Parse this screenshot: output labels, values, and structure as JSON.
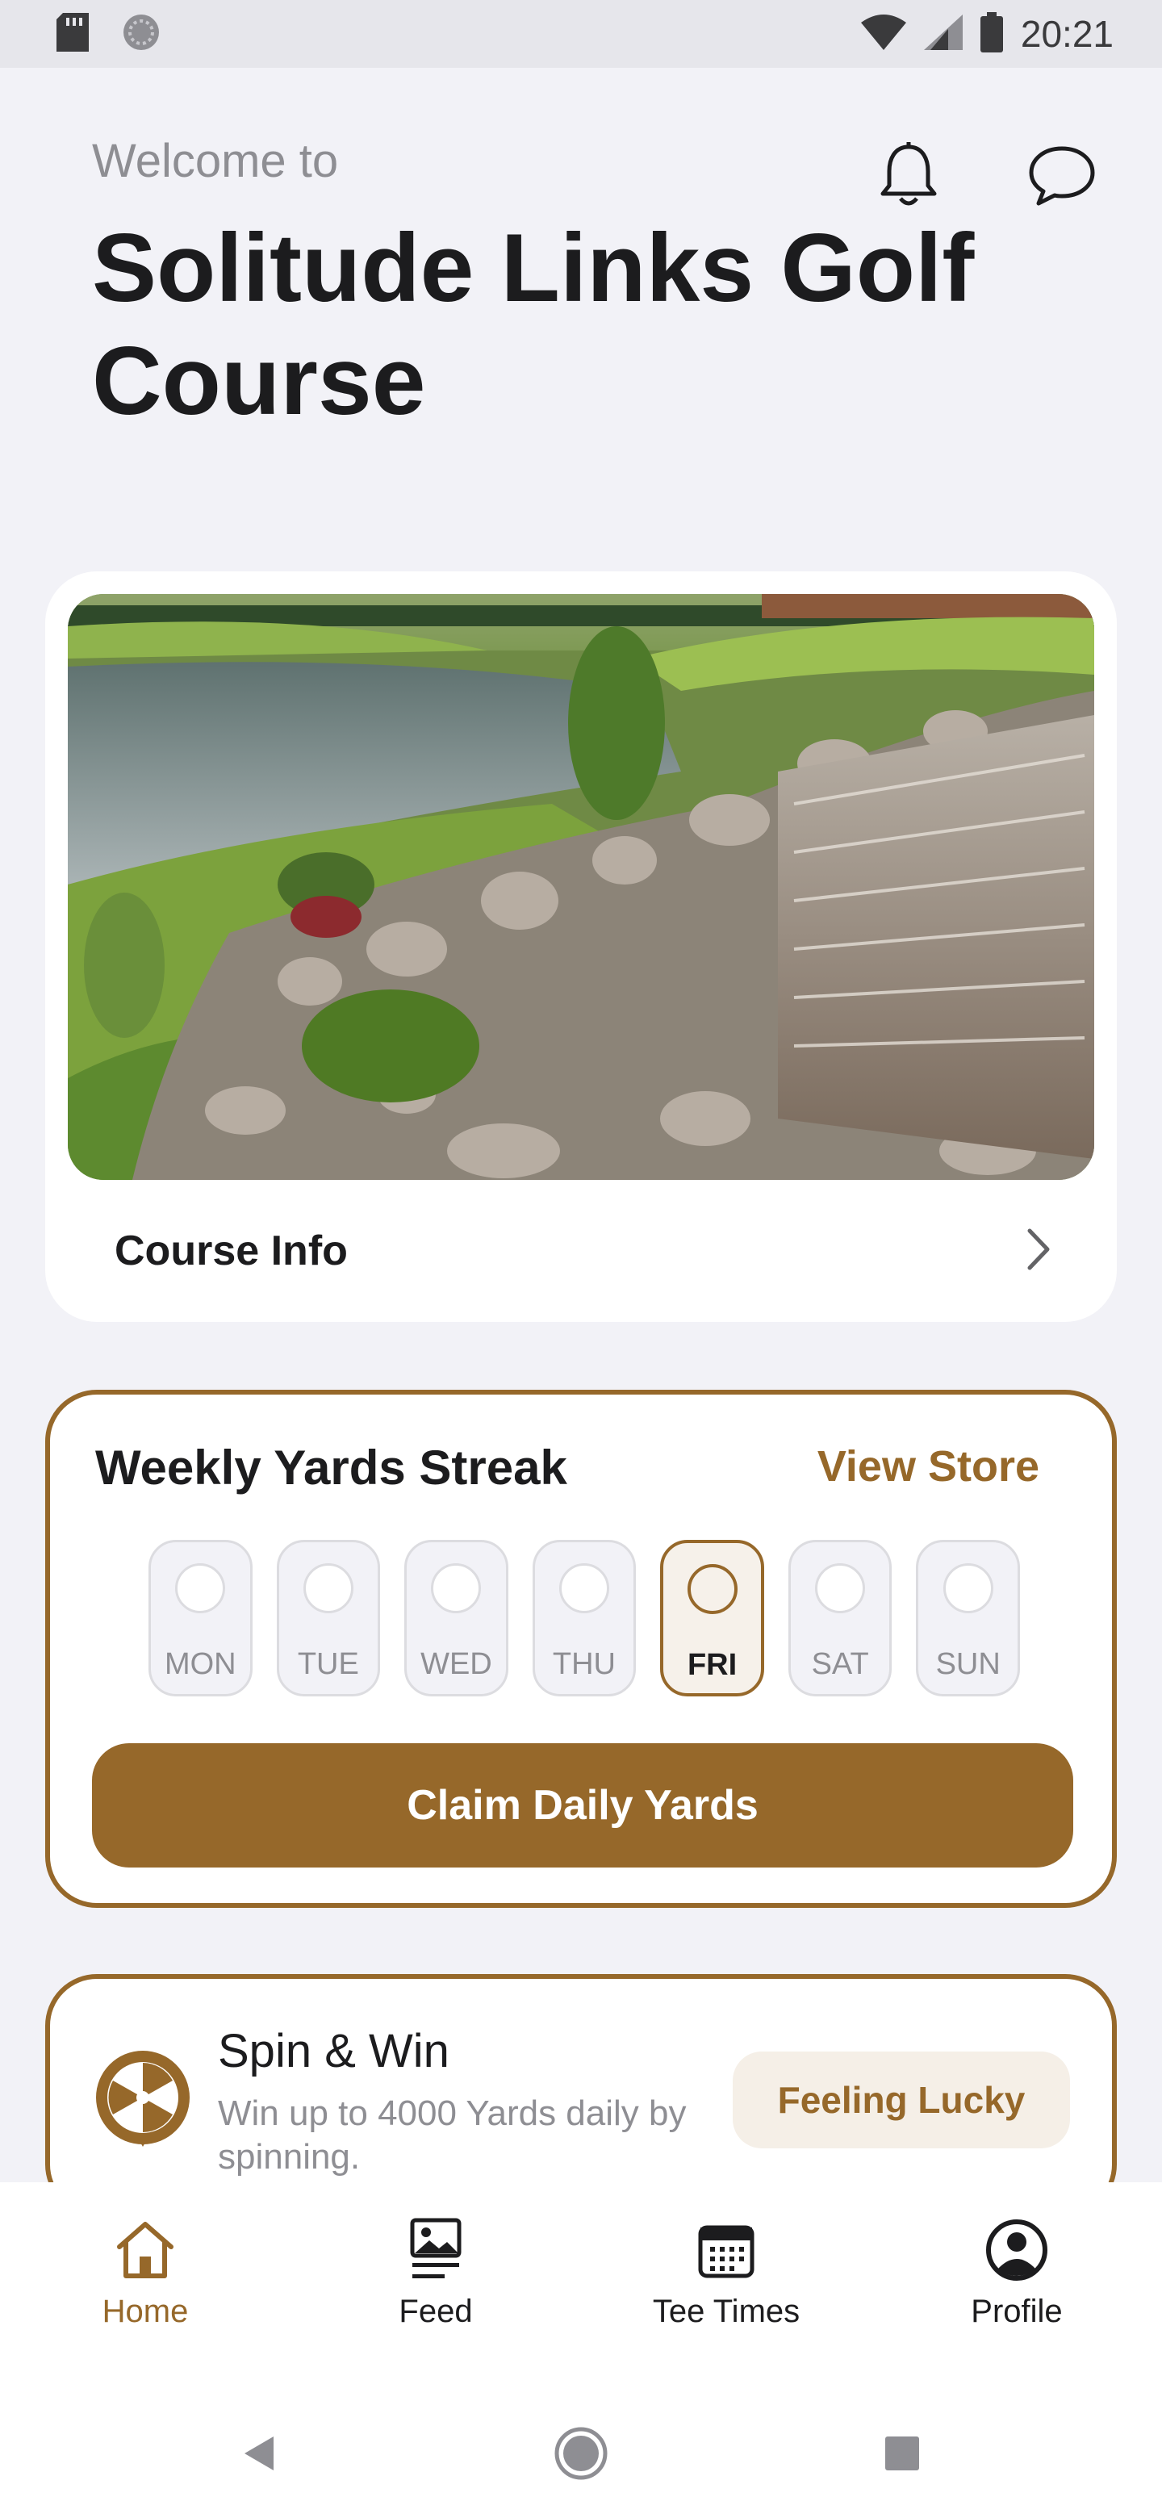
{
  "status_bar": {
    "time": "20:21"
  },
  "header": {
    "welcome": "Welcome to",
    "title": "Solitude Links Golf Course",
    "icons": [
      "bell-icon",
      "chat-icon"
    ]
  },
  "course_card": {
    "image_alt": "Golf course lake with rock waterfall",
    "info_label": "Course Info"
  },
  "streak": {
    "title": "Weekly Yards Streak",
    "view_store": "View Store",
    "days": [
      "MON",
      "TUE",
      "WED",
      "THU",
      "FRI",
      "SAT",
      "SUN"
    ],
    "active_day": "FRI",
    "claim_label": "Claim Daily Yards"
  },
  "spin": {
    "title": "Spin & Win",
    "subtitle": "Win up to 4000 Yards daily by spinning.",
    "button": "Feeling Lucky"
  },
  "tabs": [
    {
      "label": "Home",
      "icon": "home-icon",
      "active": true
    },
    {
      "label": "Feed",
      "icon": "feed-icon",
      "active": false
    },
    {
      "label": "Tee Times",
      "icon": "calendar-icon",
      "active": false
    },
    {
      "label": "Profile",
      "icon": "profile-icon",
      "active": false
    }
  ],
  "colors": {
    "accent": "#96682a",
    "background": "#f2f2f7",
    "card": "#ffffff",
    "muted_text": "#8e8e93"
  }
}
